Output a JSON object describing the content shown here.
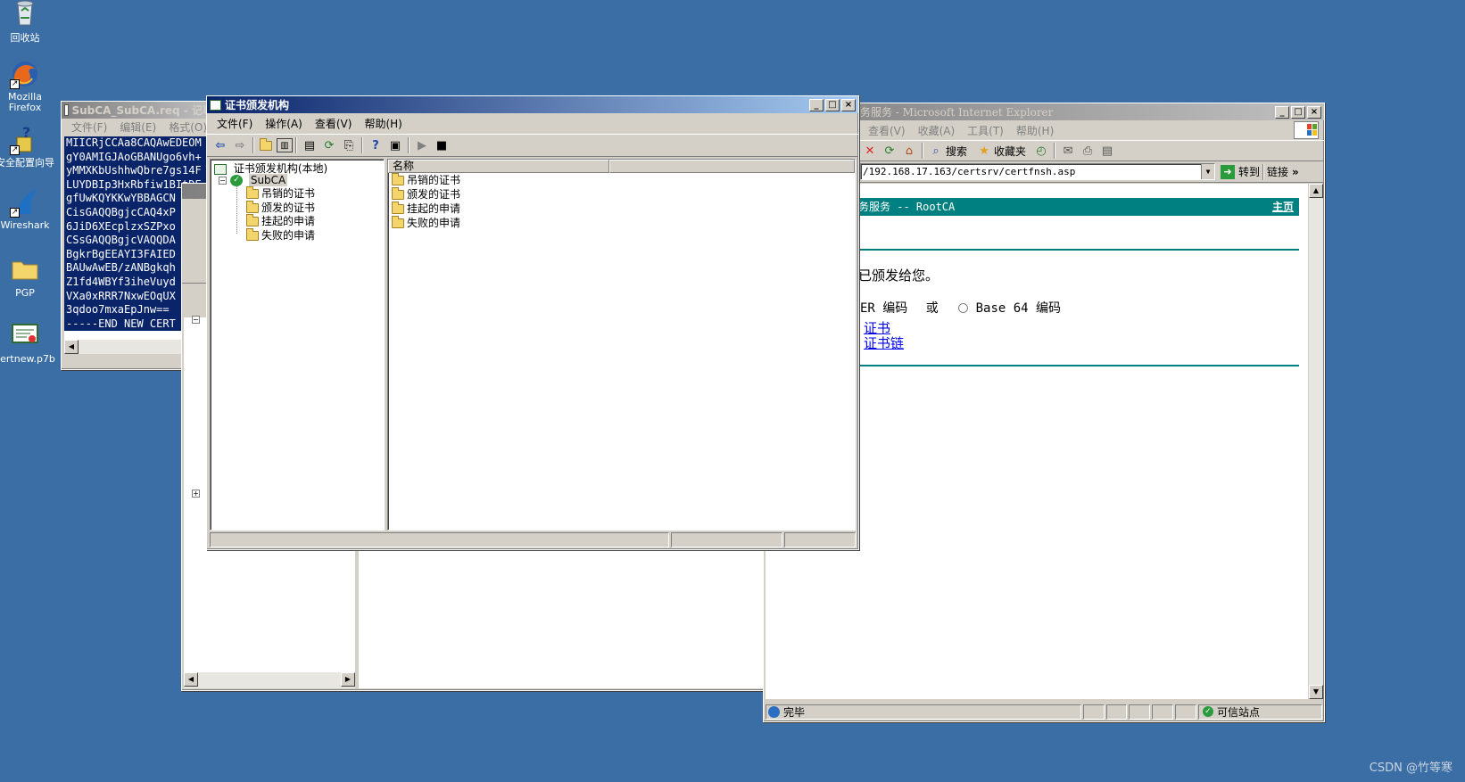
{
  "desktop": {
    "icons": [
      {
        "label": "回收站",
        "icon": "recycle-bin-icon"
      },
      {
        "label": "Mozilla Firefox",
        "icon": "firefox-icon"
      },
      {
        "label": "安全配置向导",
        "icon": "security-wizard-icon"
      },
      {
        "label": "Wireshark",
        "icon": "wireshark-icon"
      },
      {
        "label": "PGP",
        "icon": "folder-icon"
      },
      {
        "label": "certnew.p7b",
        "icon": "certificate-file-icon"
      }
    ]
  },
  "notepad": {
    "title": "SubCA_SubCA.req - 记事",
    "menu": [
      "文件(F)",
      "编辑(E)",
      "格式(O)"
    ],
    "lines": [
      "MIICRjCCAa8CAQAwEDEOM",
      "gY0AMIGJAoGBANUgo6vh+",
      "yMMXKbUshhwQbre7gs14F",
      "LUYDBIp3HxRbfiw1BItDE",
      "gfUwKQYKKwYBBAGCN",
      "CisGAQQBgjcCAQ4xP",
      "6JiD6XEcplzxSZPxo",
      "CSsGAQQBgjcVAQQDA",
      "BgkrBgEEAYI3FAIED",
      "BAUwAwEB/zANBgkqh",
      "Z1fd4WBYf3iheVuyd",
      "VXa0xRRR7NxwEOqUX",
      "3qdoo7mxaEpJnw==",
      "-----END NEW CERT"
    ]
  },
  "ca_window": {
    "title": "证书颁发机构",
    "menu": [
      "文件(F)",
      "操作(A)",
      "查看(V)",
      "帮助(H)"
    ],
    "tree_root": "证书颁发机构(本地)",
    "tree_ca": "SubCA",
    "tree_children": [
      "吊销的证书",
      "颁发的证书",
      "挂起的申请",
      "失败的申请"
    ],
    "column_name": "名称",
    "list_items": [
      "吊销的证书",
      "颁发的证书",
      "挂起的申请",
      "失败的申请"
    ]
  },
  "ie_window": {
    "title": "务服务 - Microsoft Internet Explorer",
    "menu": [
      "查看(V)",
      "收藏(A)",
      "工具(T)",
      "帮助(H)"
    ],
    "toolbar": {
      "search": "搜索",
      "favorites": "收藏夹"
    },
    "address": "/192.168.17.163/certsrv/certfnsh.asp",
    "go_label": "转到",
    "links_label": "链接",
    "header_text": "务服务 --  RootCA",
    "home_link": "主页",
    "issued_text": "已颁发给您。",
    "encoding_der": "ER 编码",
    "encoding_or": "或",
    "encoding_base64": "Base 64 编码",
    "link_cert": "证书",
    "link_chain": "证书链",
    "status_done": "完毕",
    "status_zone": "可信站点",
    "accent_color": "#008080"
  },
  "watermark": "CSDN @竹等寒"
}
